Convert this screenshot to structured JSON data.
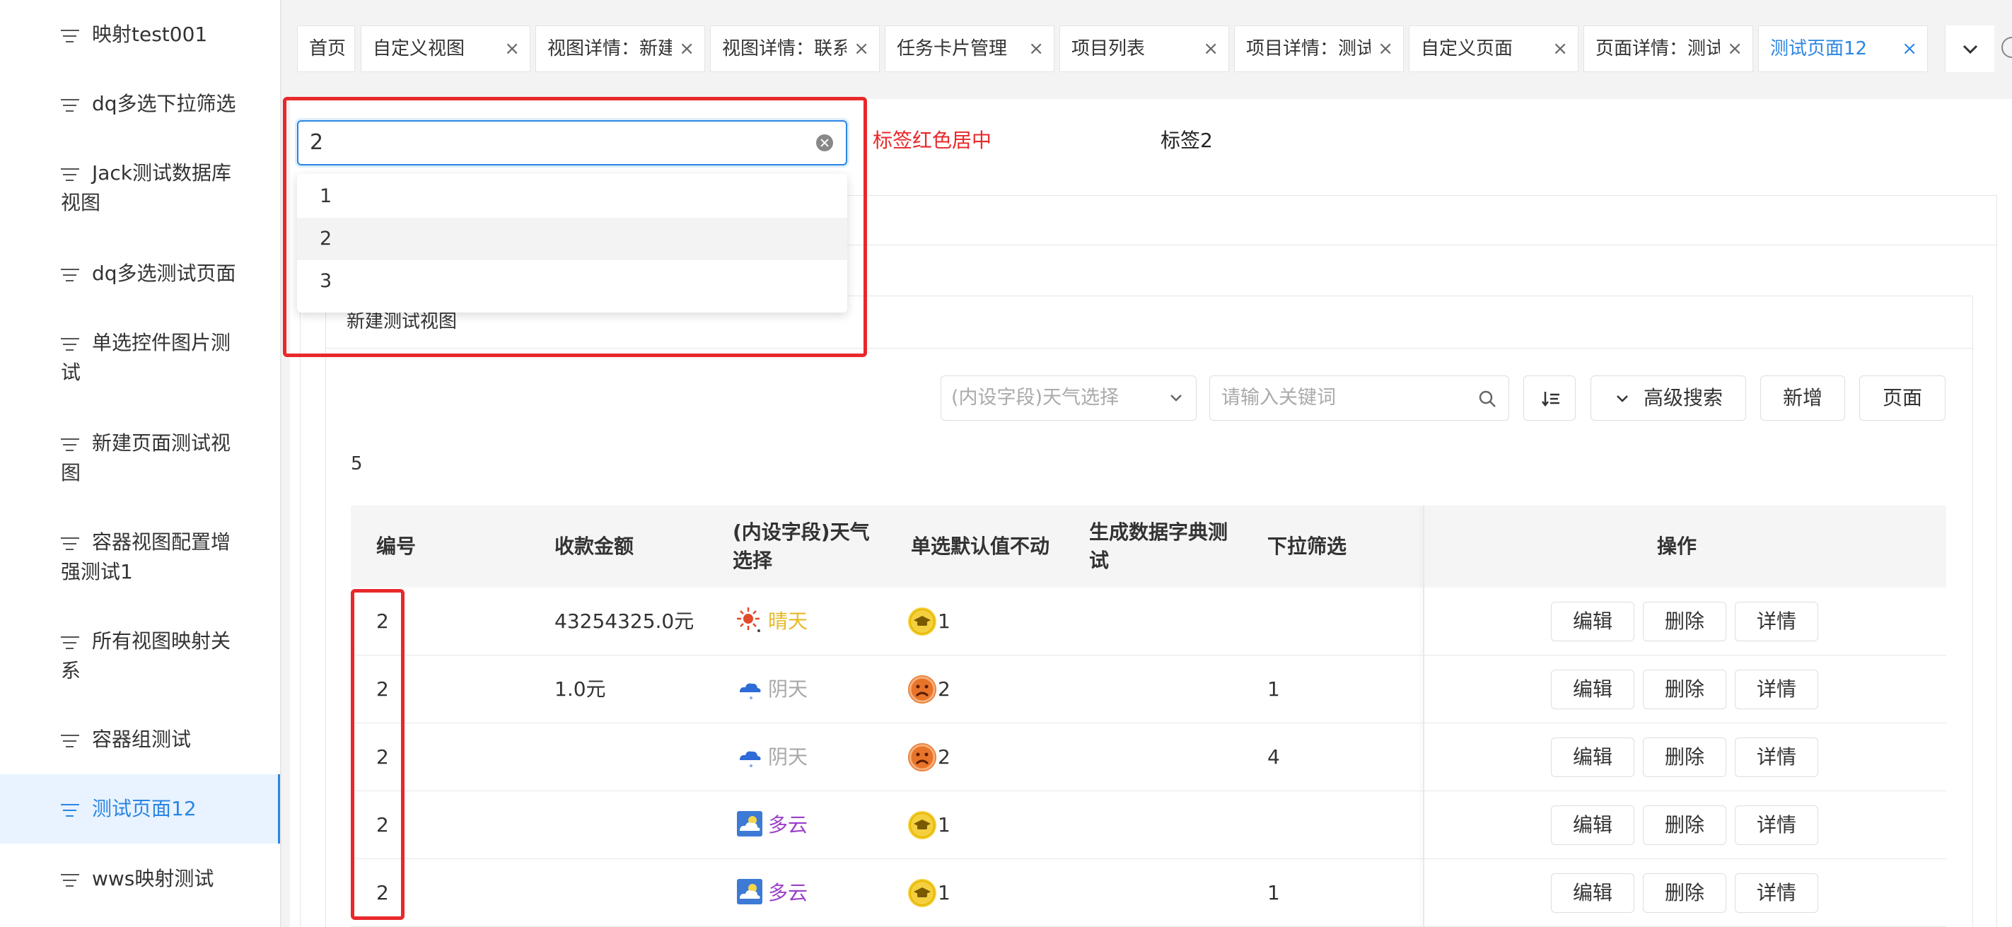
{
  "sidebar": {
    "items": [
      {
        "label": "映射test001"
      },
      {
        "label": "dq多选下拉筛选"
      },
      {
        "label": "Jack测试数据库视图"
      },
      {
        "label": "dq多选测试页面"
      },
      {
        "label": "单选控件图片测试"
      },
      {
        "label": "新建页面测试视图"
      },
      {
        "label": "容器视图配置增强测试1"
      },
      {
        "label": "所有视图映射关系"
      },
      {
        "label": "容器组测试"
      },
      {
        "label": "测试页面12",
        "active": true
      },
      {
        "label": "wws映射测试"
      }
    ]
  },
  "tabs": [
    {
      "label": "首页",
      "closable": false
    },
    {
      "label": "自定义视图",
      "closable": true
    },
    {
      "label": "视图详情：新建",
      "closable": true
    },
    {
      "label": "视图详情：联系",
      "closable": true
    },
    {
      "label": "任务卡片管理",
      "closable": true
    },
    {
      "label": "项目列表",
      "closable": true
    },
    {
      "label": "项目详情：测试",
      "closable": true
    },
    {
      "label": "自定义页面",
      "closable": true
    },
    {
      "label": "页面详情：测试",
      "closable": true
    },
    {
      "label": "测试页面12",
      "closable": true,
      "active": true
    }
  ],
  "tab_close_glyph": "×",
  "select": {
    "value": "2",
    "options": [
      "1",
      "2",
      "3"
    ],
    "selected_index": 1
  },
  "labels": {
    "red_center": "标签红色居中",
    "label2": "标签2"
  },
  "panel": {
    "title": "新建测试视图"
  },
  "toolbar": {
    "weather_select_placeholder": "(内设字段)天气选择",
    "search_placeholder": "请输入关键词",
    "advanced_search": "高级搜索",
    "add": "新增",
    "page": "页面"
  },
  "record_count": "5",
  "table": {
    "columns": [
      "编号",
      "收款金额",
      "(内设字段)天气选择",
      "单选默认值不动",
      "生成数据字典测试",
      "下拉筛选",
      "操作"
    ],
    "rows": [
      {
        "id": "2",
        "amount": "43254325.0元",
        "weather": "晴天",
        "weather_icon": "sun-icon",
        "weather_color": "#e8b923",
        "radio_icon": "graduation-cap-icon",
        "radio": "1",
        "dict": "",
        "dropdown": ""
      },
      {
        "id": "2",
        "amount": "1.0元",
        "weather": "阴天",
        "weather_icon": "rain-cloud-icon",
        "weather_color": "#a8a8a8",
        "radio_icon": "sad-face-icon",
        "radio": "2",
        "dict": "",
        "dropdown": "1"
      },
      {
        "id": "2",
        "amount": "",
        "weather": "阴天",
        "weather_icon": "rain-cloud-icon",
        "weather_color": "#a8a8a8",
        "radio_icon": "sad-face-icon",
        "radio": "2",
        "dict": "",
        "dropdown": "4"
      },
      {
        "id": "2",
        "amount": "",
        "weather": "多云",
        "weather_icon": "cloudy-icon",
        "weather_color": "#9b3fc8",
        "radio_icon": "graduation-cap-icon",
        "radio": "1",
        "dict": "",
        "dropdown": ""
      },
      {
        "id": "2",
        "amount": "",
        "weather": "多云",
        "weather_icon": "cloudy-icon",
        "weather_color": "#9b3fc8",
        "radio_icon": "graduation-cap-icon",
        "radio": "1",
        "dict": "",
        "dropdown": "1"
      }
    ],
    "actions": {
      "edit": "编辑",
      "delete": "删除",
      "detail": "详情"
    }
  },
  "colors": {
    "accent": "#2b85e4",
    "annotation_red": "#e8282b",
    "emoji_yellow": "#f4d03f",
    "emoji_orange": "#e8742a"
  }
}
